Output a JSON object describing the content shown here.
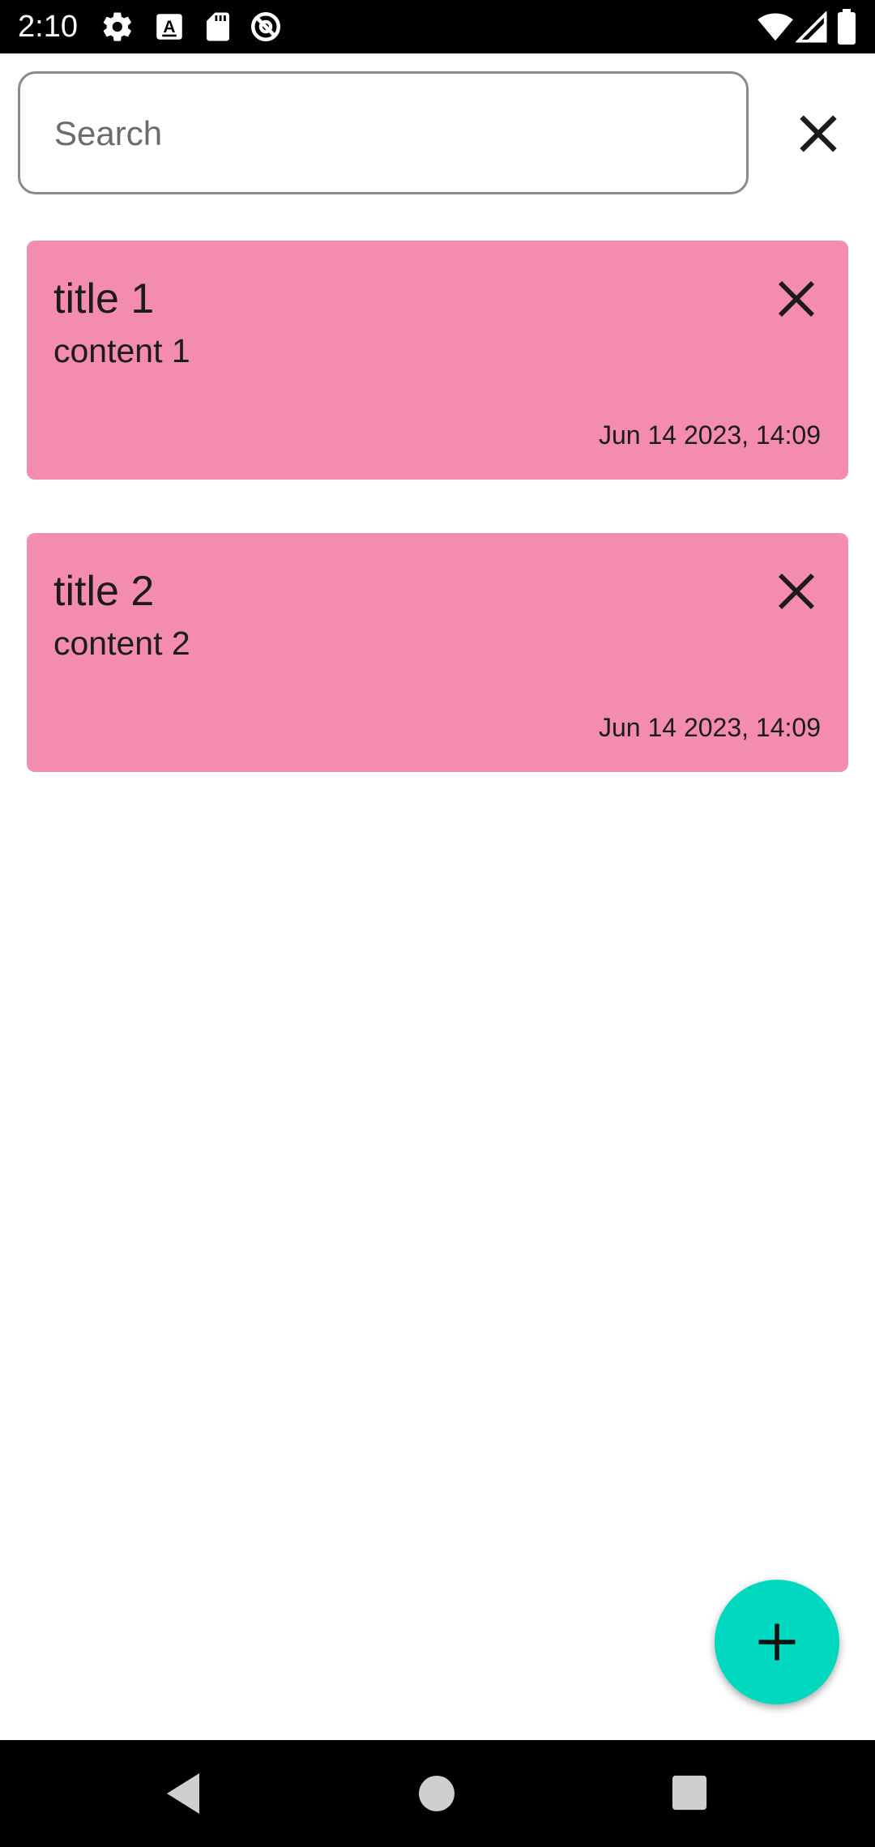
{
  "status_bar": {
    "time": "2:10",
    "left_icons": [
      "gear-icon",
      "text-a-icon",
      "sd-card-icon",
      "no-disturb-icon"
    ],
    "right_icons": [
      "wifi-icon",
      "signal-icon",
      "battery-icon"
    ]
  },
  "search": {
    "placeholder": "Search",
    "value": "",
    "clear_icon": "close-icon"
  },
  "notes": [
    {
      "title": "title 1",
      "content": "content 1",
      "date": "Jun 14 2023, 14:09",
      "delete_icon": "close-icon"
    },
    {
      "title": "title 2",
      "content": "content 2",
      "date": "Jun 14 2023, 14:09",
      "delete_icon": "close-icon"
    }
  ],
  "fab": {
    "icon": "plus-icon"
  },
  "nav_bar": {
    "buttons": [
      "back-icon",
      "home-icon",
      "recents-icon"
    ]
  },
  "colors": {
    "card": "#f48cae",
    "fab": "#00d9c0",
    "text": "#1d1a1f",
    "bars": "#000000"
  }
}
